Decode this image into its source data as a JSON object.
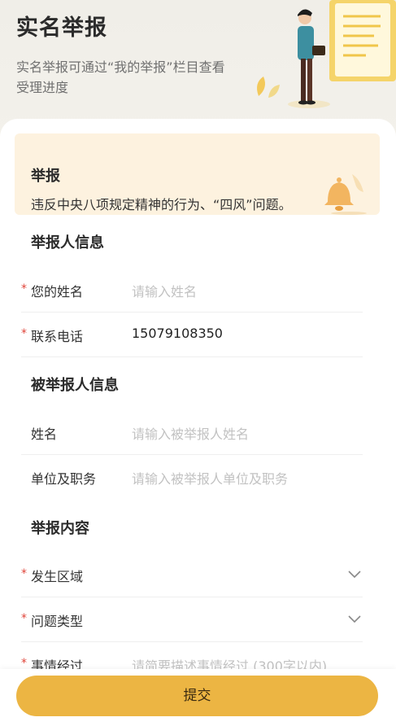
{
  "header": {
    "title": "实名举报",
    "subtitle": "实名举报可通过“我的举报”栏目查看受理进度"
  },
  "notice": {
    "title": "举报",
    "text": "违反中央八项规定精神的行为、“四风”问题。"
  },
  "sections": {
    "reporter": {
      "title": "举报人信息",
      "name_label": "您的姓名",
      "name_placeholder": "请输入姓名",
      "phone_label": "联系电话",
      "phone_value": "15079108350"
    },
    "reported": {
      "title": "被举报人信息",
      "name_label": "姓名",
      "name_placeholder": "请输入被举报人姓名",
      "unit_label": "单位及职务",
      "unit_placeholder": "请输入被举报人单位及职务"
    },
    "content": {
      "title": "举报内容",
      "area_label": "发生区域",
      "type_label": "问题类型",
      "detail_label": "事情经过",
      "detail_placeholder": "请简要描述事情经过 (300字以内)"
    }
  },
  "required_mark": "*",
  "submit_label": "提交",
  "colors": {
    "accent": "#ecb543",
    "required": "#e0453a",
    "notice_bg": "#fdf2df"
  },
  "icons": [
    "report-illustration",
    "bell-icon",
    "chevron-down-icon"
  ]
}
